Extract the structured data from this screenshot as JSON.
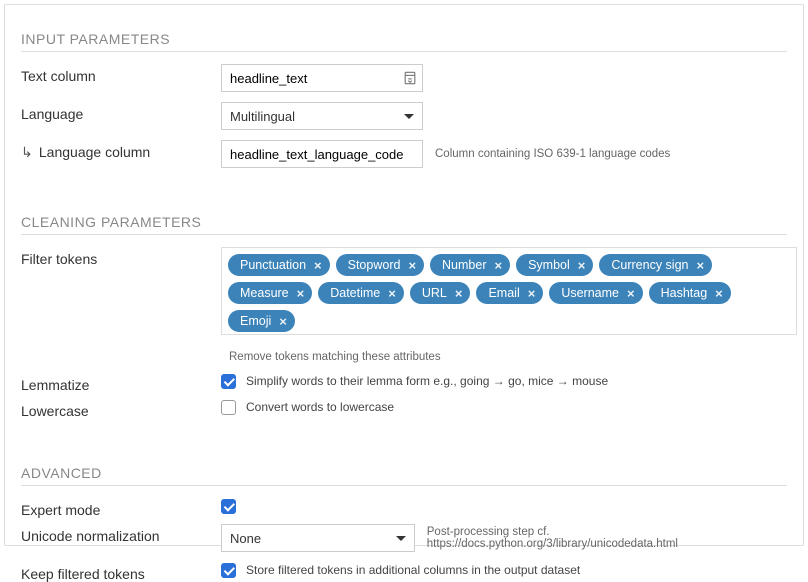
{
  "sections": {
    "input": "INPUT PARAMETERS",
    "cleaning": "CLEANING PARAMETERS",
    "advanced": "ADVANCED"
  },
  "input": {
    "text_column_label": "Text column",
    "text_column_value": "headline_text",
    "language_label": "Language",
    "language_value": "Multilingual",
    "language_column_label": "Language column",
    "language_column_value": "headline_text_language_code",
    "language_column_hint": "Column containing ISO 639-1 language codes"
  },
  "cleaning": {
    "filter_label": "Filter tokens",
    "tags": [
      "Punctuation",
      "Stopword",
      "Number",
      "Symbol",
      "Currency sign",
      "Measure",
      "Datetime",
      "URL",
      "Email",
      "Username",
      "Hashtag",
      "Emoji"
    ],
    "filter_hint": "Remove tokens matching these attributes",
    "lemmatize_label": "Lemmatize",
    "lemmatize_checked": true,
    "lemmatize_desc": "Simplify words to their lemma form e.g., going → go, mice → mouse",
    "lowercase_label": "Lowercase",
    "lowercase_checked": false,
    "lowercase_desc": "Convert words to lowercase"
  },
  "advanced": {
    "expert_label": "Expert mode",
    "expert_checked": true,
    "unicode_label": "Unicode normalization",
    "unicode_value": "None",
    "unicode_hint": "Post-processing step cf. https://docs.python.org/3/library/unicodedata.html",
    "keep_label": "Keep filtered tokens",
    "keep_checked": true,
    "keep_desc": "Store filtered tokens in additional columns in the output dataset"
  }
}
